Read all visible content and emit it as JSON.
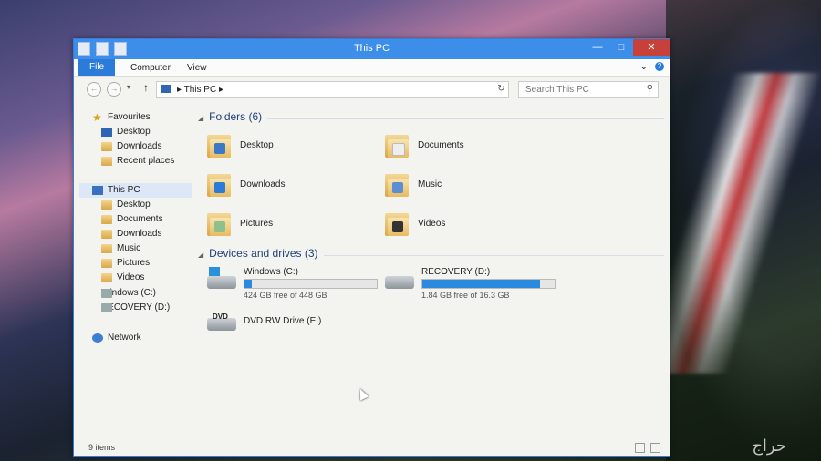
{
  "window": {
    "title": "This PC"
  },
  "ribbon": {
    "tabs": [
      "File",
      "Computer",
      "View"
    ]
  },
  "address": {
    "path_separator": "▸",
    "location": "This PC",
    "search_placeholder": "Search This PC"
  },
  "nav": {
    "favourites": "Favourites",
    "fav_items": [
      "Desktop",
      "Downloads",
      "Recent places"
    ],
    "this_pc": "This PC",
    "pc_items": [
      "Desktop",
      "Documents",
      "Downloads",
      "Music",
      "Pictures",
      "Videos",
      "Windows (C:)",
      "RECOVERY (D:)"
    ],
    "network": "Network"
  },
  "content": {
    "folders_header": "Folders (6)",
    "folders": [
      "Desktop",
      "Documents",
      "Downloads",
      "Music",
      "Pictures",
      "Videos"
    ],
    "devices_header": "Devices and drives (3)",
    "drives": [
      {
        "name": "Windows (C:)",
        "free_text": "424 GB free of 448 GB",
        "used_fraction": 0.054
      },
      {
        "name": "RECOVERY (D:)",
        "free_text": "1.84 GB free of 16.3 GB",
        "used_fraction": 0.887
      },
      {
        "name": "DVD RW Drive (E:)"
      }
    ]
  },
  "status": {
    "count": "9 items"
  },
  "wallpaper": {
    "watermark": "حراج"
  },
  "colors": {
    "accent": "#3d8ee8",
    "close": "#c7403a",
    "bar_fill": "#2a8ae0"
  }
}
